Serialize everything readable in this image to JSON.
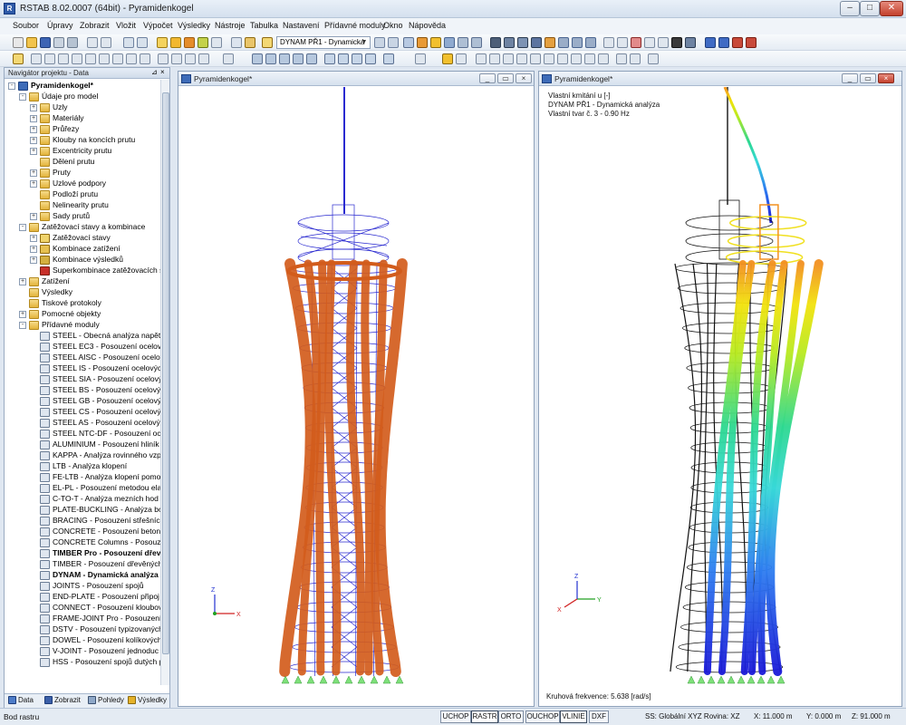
{
  "window": {
    "title": "RSTAB 8.02.0007 (64bit) - Pyramidenkogel",
    "app_icon": "rstab-app-icon"
  },
  "menu": [
    "Soubor",
    "Úpravy",
    "Zobrazit",
    "Vložit",
    "Výpočet",
    "Výsledky",
    "Nástroje",
    "Tabulka",
    "Nastavení",
    "Přídavné moduly",
    "Okno",
    "Nápověda"
  ],
  "toolbar": {
    "load_case_combo": "DYNAM PŘ1 - Dynamická a"
  },
  "navigator": {
    "title": "Navigátor projektu - Data",
    "tree": [
      {
        "label": "Pyramidenkogel*",
        "level": 0,
        "bold": true,
        "expander": "-",
        "icon": "project-icon"
      },
      {
        "label": "Údaje pro model",
        "level": 1,
        "expander": "-",
        "icon": "folder-icon"
      },
      {
        "label": "Uzly",
        "level": 2,
        "expander": "+",
        "icon": "folder-icon"
      },
      {
        "label": "Materiály",
        "level": 2,
        "expander": "+",
        "icon": "folder-icon"
      },
      {
        "label": "Průřezy",
        "level": 2,
        "expander": "+",
        "icon": "folder-icon"
      },
      {
        "label": "Klouby na koncích prutu",
        "level": 2,
        "expander": "+",
        "icon": "folder-icon"
      },
      {
        "label": "Excentricity prutu",
        "level": 2,
        "expander": "+",
        "icon": "folder-icon"
      },
      {
        "label": "Dělení prutu",
        "level": 2,
        "expander": "",
        "icon": "folder-icon"
      },
      {
        "label": "Pruty",
        "level": 2,
        "expander": "+",
        "icon": "folder-icon"
      },
      {
        "label": "Uzlové podpory",
        "level": 2,
        "expander": "+",
        "icon": "folder-icon"
      },
      {
        "label": "Podloží prutu",
        "level": 2,
        "expander": "",
        "icon": "folder-icon"
      },
      {
        "label": "Nelinearity prutu",
        "level": 2,
        "expander": "",
        "icon": "folder-icon"
      },
      {
        "label": "Sady prutů",
        "level": 2,
        "expander": "+",
        "icon": "folder-icon"
      },
      {
        "label": "Zatěžovací stavy a kombinace",
        "level": 1,
        "expander": "-",
        "icon": "folder-icon"
      },
      {
        "label": "Zatěžovací stavy",
        "level": 2,
        "expander": "+",
        "icon": "load-case-icon"
      },
      {
        "label": "Kombinace zatížení",
        "level": 2,
        "expander": "+",
        "icon": "load-combination-icon"
      },
      {
        "label": "Kombinace výsledků",
        "level": 2,
        "expander": "+",
        "icon": "result-combination-icon"
      },
      {
        "label": "Superkombinace zatěžovacích s",
        "level": 2,
        "expander": "",
        "icon": "super-combination-icon"
      },
      {
        "label": "Zatížení",
        "level": 1,
        "expander": "+",
        "icon": "folder-icon"
      },
      {
        "label": "Výsledky",
        "level": 1,
        "expander": "",
        "icon": "folder-icon"
      },
      {
        "label": "Tiskové protokoly",
        "level": 1,
        "expander": "",
        "icon": "folder-icon"
      },
      {
        "label": "Pomocné objekty",
        "level": 1,
        "expander": "+",
        "icon": "folder-icon"
      },
      {
        "label": "Přídavné moduly",
        "level": 1,
        "expander": "-",
        "icon": "folder-icon"
      },
      {
        "label": "STEEL - Obecná analýza napětí",
        "level": 2,
        "icon": "module-icon"
      },
      {
        "label": "STEEL EC3 - Posouzení ocelový",
        "level": 2,
        "icon": "module-icon"
      },
      {
        "label": "STEEL AISC - Posouzení ocelovy",
        "level": 2,
        "icon": "module-icon"
      },
      {
        "label": "STEEL IS - Posouzení ocelových",
        "level": 2,
        "icon": "module-icon"
      },
      {
        "label": "STEEL SIA - Posouzení ocelovýc",
        "level": 2,
        "icon": "module-icon"
      },
      {
        "label": "STEEL BS - Posouzení ocelových",
        "level": 2,
        "icon": "module-icon"
      },
      {
        "label": "STEEL GB - Posouzení ocelových",
        "level": 2,
        "icon": "module-icon"
      },
      {
        "label": "STEEL CS - Posouzení ocelových",
        "level": 2,
        "icon": "module-icon"
      },
      {
        "label": "STEEL AS - Posouzení ocelových",
        "level": 2,
        "icon": "module-icon"
      },
      {
        "label": "STEEL NTC-DF - Posouzení oce",
        "level": 2,
        "icon": "module-icon"
      },
      {
        "label": "ALUMINIUM - Posouzení hliník",
        "level": 2,
        "icon": "module-icon"
      },
      {
        "label": "KAPPA - Analýza rovinného vzp",
        "level": 2,
        "icon": "module-icon"
      },
      {
        "label": "LTB - Analýza klopení",
        "level": 2,
        "icon": "module-icon"
      },
      {
        "label": "FE-LTB - Analýza klopení pomo",
        "level": 2,
        "icon": "module-icon"
      },
      {
        "label": "EL-PL - Posouzení metodou ela",
        "level": 2,
        "icon": "module-icon"
      },
      {
        "label": "C-TO-T - Analýza mezních hod",
        "level": 2,
        "icon": "module-icon"
      },
      {
        "label": "PLATE-BUCKLING - Analýza bo",
        "level": 2,
        "icon": "module-icon"
      },
      {
        "label": "BRACING - Posouzení střešních",
        "level": 2,
        "icon": "module-icon"
      },
      {
        "label": "CONCRETE - Posouzení betono",
        "level": 2,
        "icon": "module-icon"
      },
      {
        "label": "CONCRETE Columns - Posouze",
        "level": 2,
        "icon": "module-icon"
      },
      {
        "label": "TIMBER Pro - Posouzení dřevě",
        "level": 2,
        "bold": true,
        "icon": "module-icon"
      },
      {
        "label": "TIMBER - Posouzení dřevěných",
        "level": 2,
        "icon": "module-icon"
      },
      {
        "label": "DYNAM - Dynamická analýza",
        "level": 2,
        "bold": true,
        "icon": "module-icon"
      },
      {
        "label": "JOINTS - Posouzení spojů",
        "level": 2,
        "icon": "module-icon"
      },
      {
        "label": "END-PLATE - Posouzení připoj",
        "level": 2,
        "icon": "module-icon"
      },
      {
        "label": "CONNECT - Posouzení kloubov",
        "level": 2,
        "icon": "module-icon"
      },
      {
        "label": "FRAME-JOINT Pro - Posouzení",
        "level": 2,
        "icon": "module-icon"
      },
      {
        "label": "DSTV - Posouzení typizovaných",
        "level": 2,
        "icon": "module-icon"
      },
      {
        "label": "DOWEL - Posouzení kolíkových",
        "level": 2,
        "icon": "module-icon"
      },
      {
        "label": "V-JOINT - Posouzení jednoduc",
        "level": 2,
        "icon": "module-icon"
      },
      {
        "label": "HSS - Posouzení spojů dutých p",
        "level": 2,
        "icon": "module-icon"
      }
    ],
    "tabs": [
      {
        "label": "Data",
        "icon": "data-tab-icon"
      },
      {
        "label": "Zobrazit",
        "icon": "display-tab-icon"
      },
      {
        "label": "Pohledy",
        "icon": "views-tab-icon"
      },
      {
        "label": "Výsledky",
        "icon": "results-tab-icon"
      }
    ]
  },
  "view_left": {
    "title": "Pyramidenkogel*",
    "axes": {
      "x": "X",
      "z": "Z"
    }
  },
  "view_right": {
    "title": "Pyramidenkogel*",
    "info_lines": [
      "Vlastní kmitání  u [-]",
      "DYNAM PŘ1 - Dynamická analýza",
      "Vlastní tvar č. 3 - 0.90 Hz"
    ],
    "footer": "Kruhová frekvence: 5.638 [rad/s]",
    "axes": {
      "x": "X",
      "y": "Y",
      "z": "Z"
    }
  },
  "statusbar": {
    "left": "Bod rastru",
    "toggles": [
      {
        "label": "UCHOP",
        "on": false
      },
      {
        "label": "RASTR",
        "on": true
      },
      {
        "label": "ORTO",
        "on": false
      },
      {
        "label": "OUCHOP",
        "on": false
      },
      {
        "label": "VLINIE",
        "on": true
      },
      {
        "label": "DXF",
        "on": false
      }
    ],
    "coords": "SS: Globální XYZ Rovina: XZ",
    "x": "X:  11.000 m",
    "y": "Y:  0.000 m",
    "z": "Z:  91.000 m"
  },
  "colors": {
    "member_orange": "#d25c1c",
    "wire_blue": "#2a2ad0",
    "support_green": "#7ee07a"
  }
}
